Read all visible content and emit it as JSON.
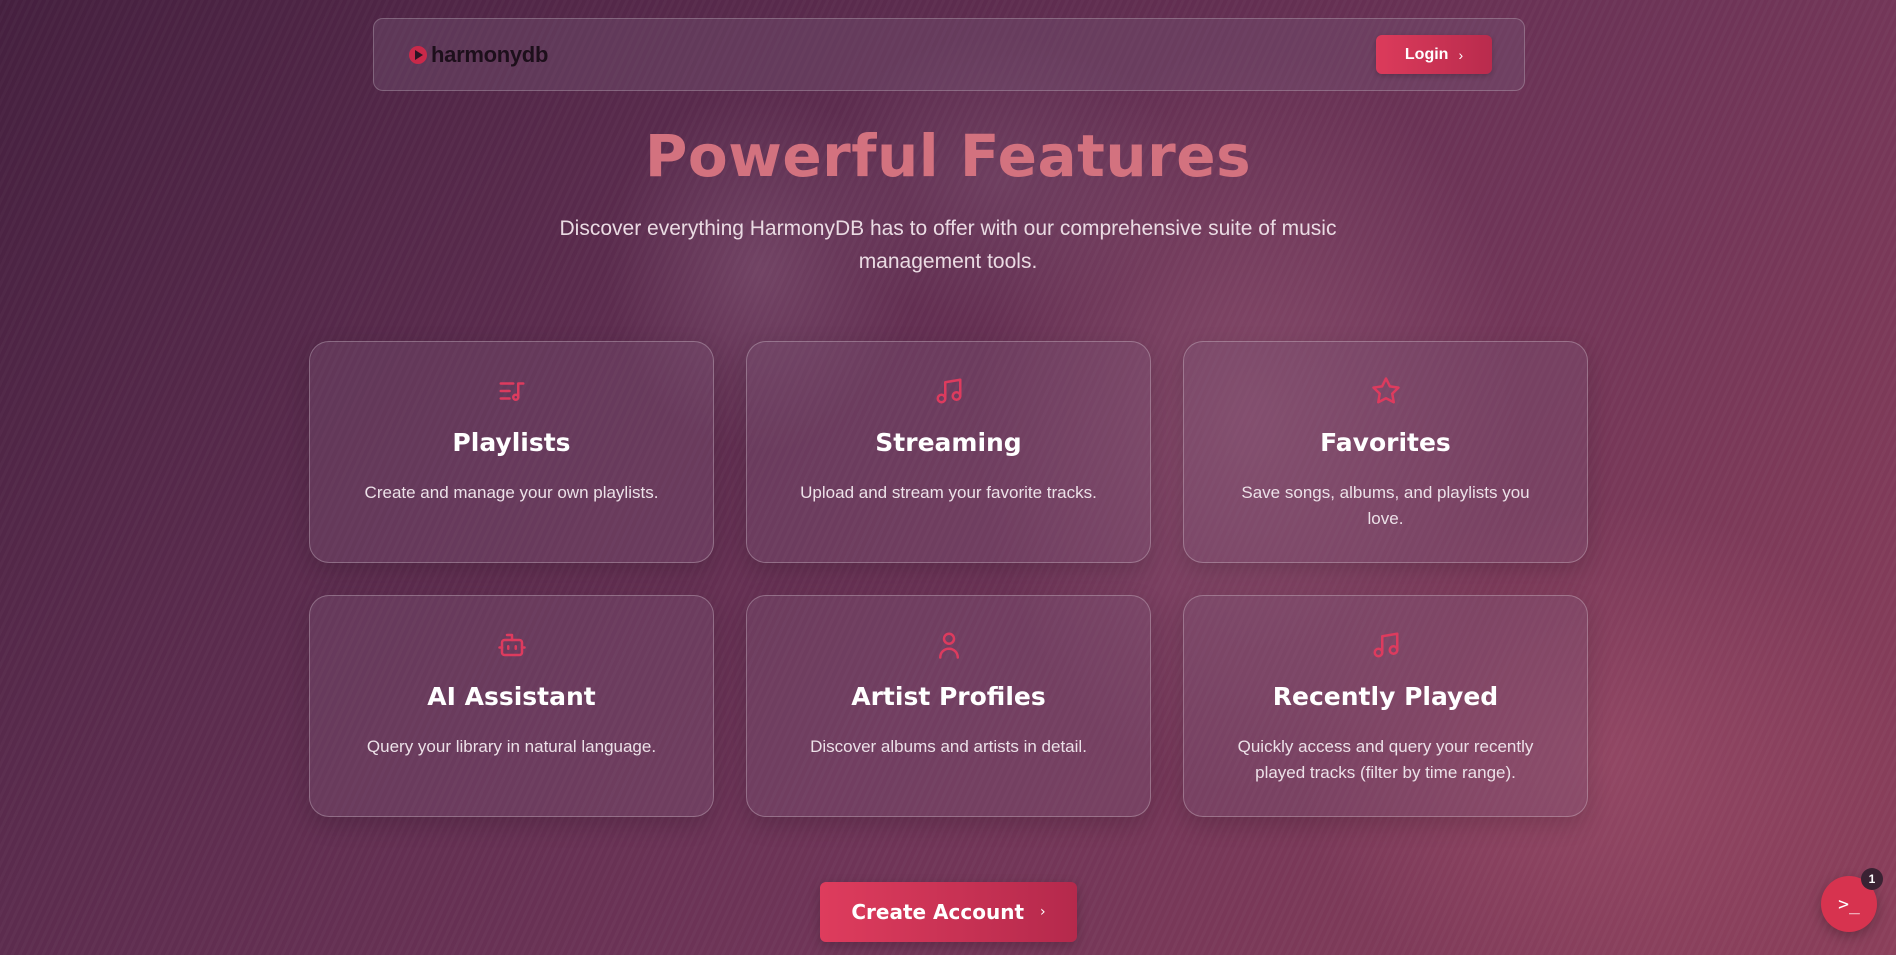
{
  "brand": {
    "name": "harmonydb",
    "icon": "play-circle-icon"
  },
  "nav": {
    "login_label": "Login",
    "login_icon": "chevron-right-icon"
  },
  "hero": {
    "title": "Powerful Features",
    "subtitle": "Discover everything HarmonyDB has to offer with our comprehensive suite of music management tools."
  },
  "features": [
    {
      "icon": "playlist-icon",
      "title": "Playlists",
      "description": "Create and manage your own playlists."
    },
    {
      "icon": "music-note-icon",
      "title": "Streaming",
      "description": "Upload and stream your favorite tracks."
    },
    {
      "icon": "star-icon",
      "title": "Favorites",
      "description": "Save songs, albums, and playlists you love."
    },
    {
      "icon": "robot-icon",
      "title": "AI Assistant",
      "description": "Query your library in natural language."
    },
    {
      "icon": "user-icon",
      "title": "Artist Profiles",
      "description": "Discover albums and artists in detail."
    },
    {
      "icon": "music-note-icon",
      "title": "Recently Played",
      "description": "Quickly access and query your recently played tracks (filter by time range)."
    }
  ],
  "cta": {
    "label": "Create Account",
    "icon": "chevron-right-icon"
  },
  "terminal_button": {
    "glyph": ">_",
    "badge_count": "1"
  },
  "colors": {
    "accent": "#dd3b5e",
    "title": "#d3727f",
    "background": "#5a2b4d"
  }
}
